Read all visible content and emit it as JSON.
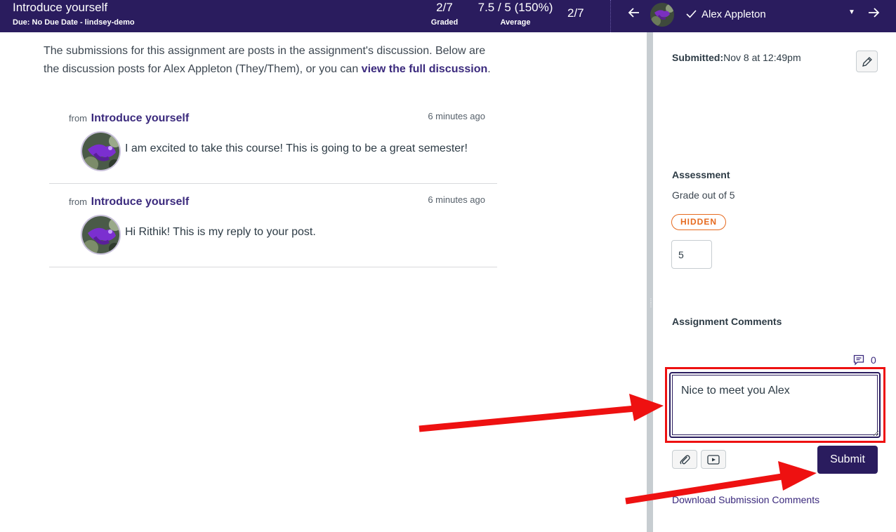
{
  "header": {
    "title": "Introduce yourself",
    "due": "Due: No Due Date - lindsey-demo",
    "graded_value": "2/7",
    "graded_label": "Graded",
    "average_value": "7.5 / 5 (150%)",
    "average_label": "Average",
    "student_count": "2/7",
    "student_name": "Alex Appleton",
    "icons": [
      "left-arrow-icon",
      "check-icon",
      "caret-down-icon",
      "right-arrow-icon"
    ]
  },
  "main": {
    "intro_text": "The submissions for this assignment are posts in the assignment's discussion. Below are the discussion posts for Alex Appleton (They/Them), or you can ",
    "intro_link": "view the full discussion",
    "intro_end": ".",
    "posts": [
      {
        "from_label": "from",
        "source": "Introduce yourself",
        "time": "6 minutes ago",
        "text": "I am excited to take this course! This is going to be a great semester!"
      },
      {
        "from_label": "from",
        "source": "Introduce yourself",
        "time": "6 minutes ago",
        "text": "Hi Rithik! This is my reply to your post."
      }
    ]
  },
  "sidebar": {
    "submitted_label": "Submitted:",
    "submitted_value": "Nov 8 at 12:49pm",
    "assessment_title": "Assessment",
    "grade_out_of": "Grade out of 5",
    "hidden_badge": "HIDDEN",
    "grade_value": "5",
    "comments_title": "Assignment Comments",
    "comment_count": "0",
    "comment_text": "Nice to meet you Alex",
    "submit_label": "Submit",
    "download_link": "Download Submission Comments"
  },
  "colors": {
    "header_bg": "#2a1c5e",
    "link": "#3b2a7d",
    "hidden_badge": "#e66a1f",
    "annotation": "#ee1111"
  }
}
